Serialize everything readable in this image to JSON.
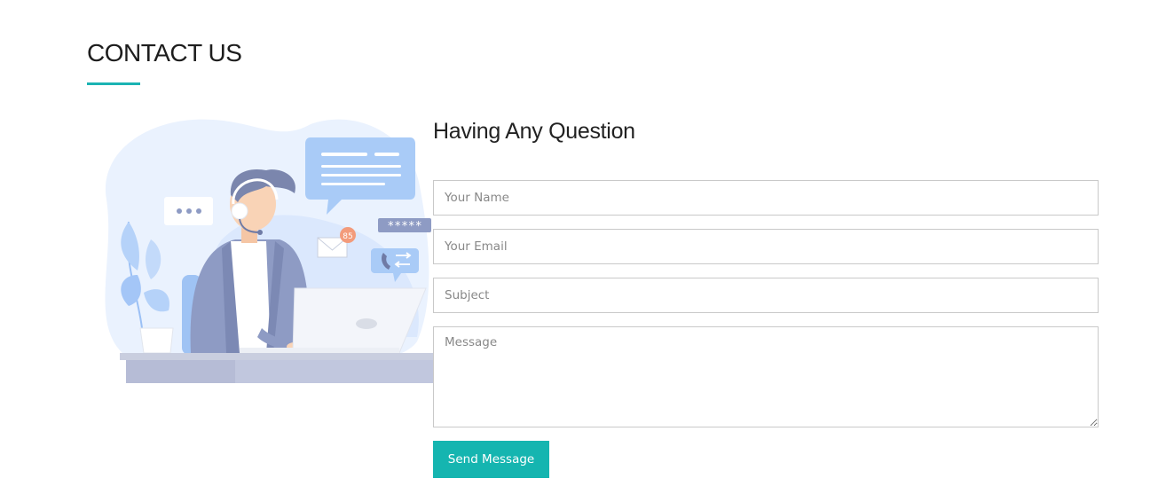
{
  "section": {
    "title": "CONTACT US"
  },
  "illustration": {
    "badge_count": "85",
    "password_mask": "*****"
  },
  "form": {
    "heading": "Having Any Question",
    "name_placeholder": "Your Name",
    "email_placeholder": "Your Email",
    "subject_placeholder": "Subject",
    "message_placeholder": "Message",
    "submit_label": "Send Message"
  },
  "colors": {
    "accent": "#1ab3b3",
    "button": "#15b5b0",
    "illustration_blue": "#a9cbf7",
    "illustration_gray": "#8e9bc4"
  }
}
